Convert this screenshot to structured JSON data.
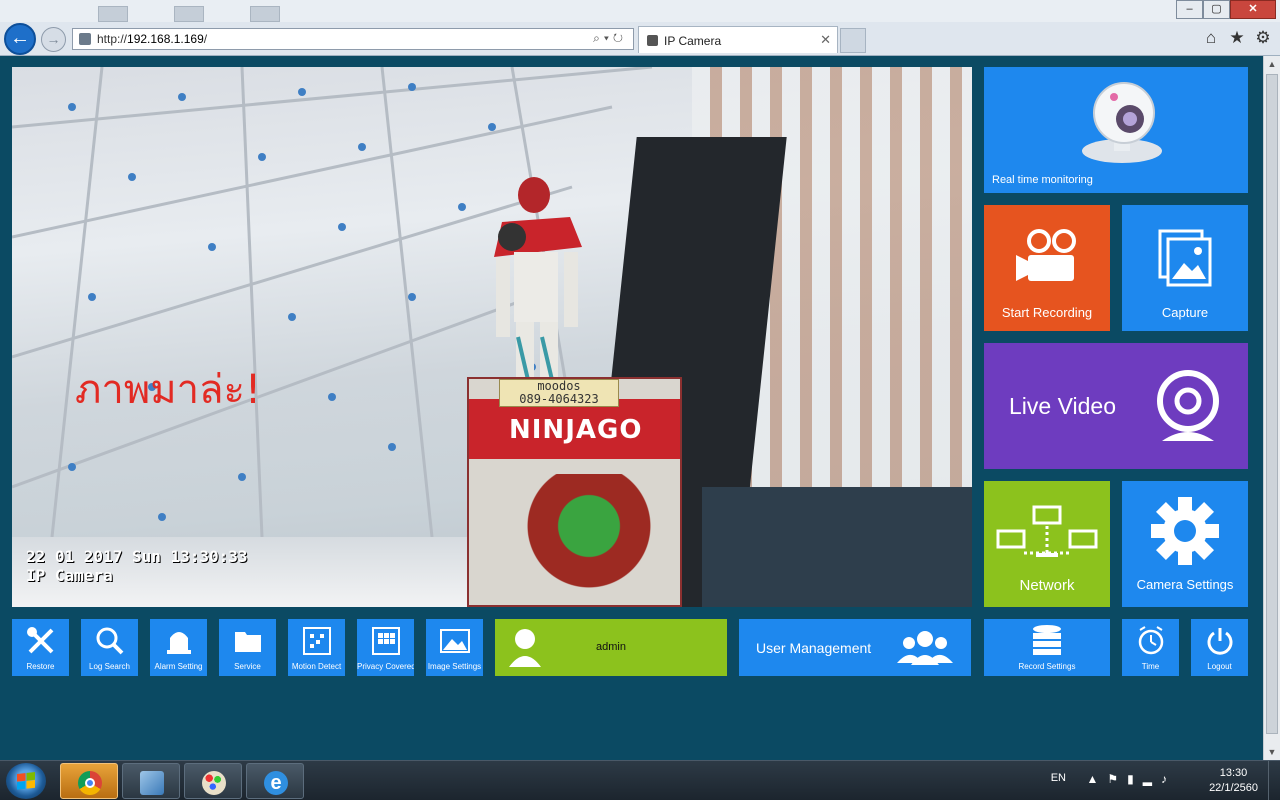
{
  "browser": {
    "url_prefix": "http://",
    "url_host": "192.168.1.169",
    "url_suffix": "/",
    "tab_title": "IP Camera",
    "tab_close": "✕",
    "back_icon": "arrow-left-icon",
    "forward_icon": "arrow-right-icon",
    "window_buttons": {
      "minimize": "–",
      "maximize": "▢",
      "close": "✕"
    },
    "toolbar_icons": [
      "home-icon",
      "star-icon",
      "gear-icon"
    ]
  },
  "camera": {
    "overlay_text": "ภาพมาล่ะ!",
    "osd_datetime": "22 01 2017 Sun 13:30:33",
    "osd_name": "IP Camera",
    "sticker_text": "moodos\n089-4064323",
    "box_brand": "NINJAGO"
  },
  "tiles": {
    "realtime": "Real time monitoring",
    "start_recording": "Start Recording",
    "capture": "Capture",
    "live_video": "Live Video",
    "network": "Network",
    "camera_settings": "Camera Settings",
    "restore": "Restore",
    "log_search": "Log Search",
    "alarm_setting": "Alarm Setting",
    "service": "Service",
    "motion_detect": "Motion Detect",
    "privacy_covered": "Privacy Covered",
    "image_settings": "Image Settings",
    "admin": "admin",
    "user_management": "User Management",
    "record_settings": "Record Settings",
    "time": "Time",
    "logout": "Logout"
  },
  "taskbar": {
    "lang": "EN",
    "time": "13:30",
    "date": "22/1/2560",
    "apps": [
      "chrome-icon",
      "network-map-icon",
      "paint-icon",
      "internet-explorer-icon"
    ]
  },
  "colors": {
    "background": "#0b4a63",
    "tile_blue": "#1e88ee",
    "tile_orange": "#e6541f",
    "tile_purple": "#6e3cbf",
    "tile_green": "#8cc21d",
    "overlay_red": "#e22a23"
  }
}
